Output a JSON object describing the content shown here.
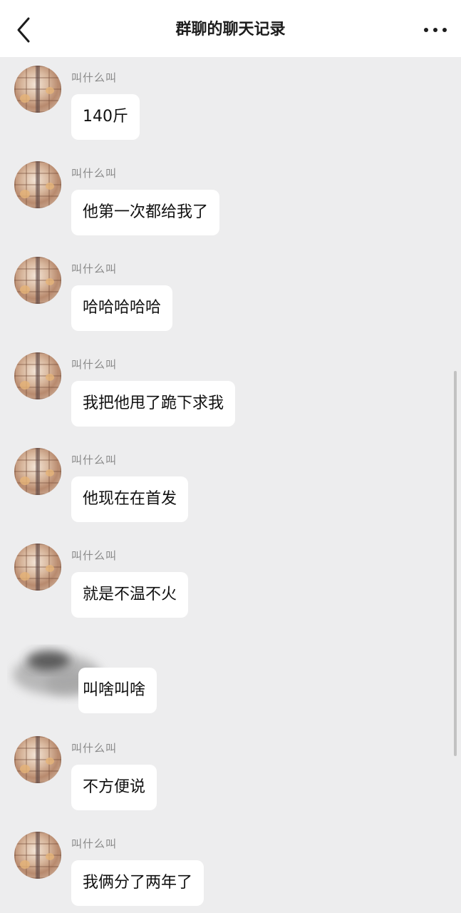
{
  "header": {
    "title": "群聊的聊天记录",
    "back_icon": "chevron-left-icon",
    "more_icon": "more-horizontal-icon"
  },
  "messages": [
    {
      "sender": "叫什么叫",
      "text": "140斤"
    },
    {
      "sender": "叫什么叫",
      "text": "他第一次都给我了"
    },
    {
      "sender": "叫什么叫",
      "text": "哈哈哈哈哈"
    },
    {
      "sender": "叫什么叫",
      "text": "我把他甩了跪下求我"
    },
    {
      "sender": "叫什么叫",
      "text": "他现在在首发"
    },
    {
      "sender": "叫什么叫",
      "text": "就是不温不火"
    },
    {
      "sender": "",
      "text": "叫啥叫啥"
    },
    {
      "sender": "叫什么叫",
      "text": "不方便说"
    },
    {
      "sender": "叫什么叫",
      "text": "我俩分了两年了"
    }
  ],
  "colors": {
    "background": "#ededee",
    "bubble": "#ffffff",
    "sender_text": "#8a8a8a"
  }
}
